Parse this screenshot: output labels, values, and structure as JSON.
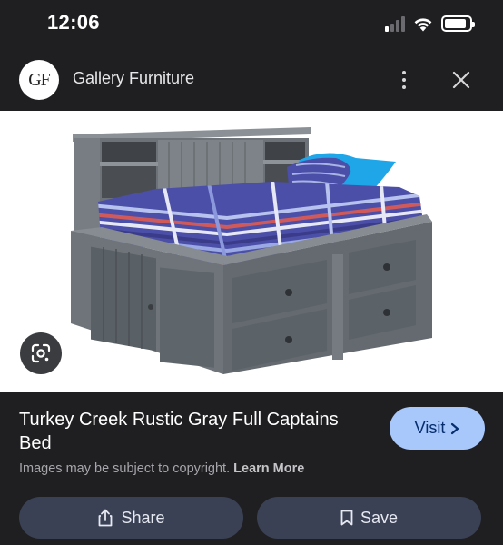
{
  "status_bar": {
    "time": "12:06",
    "signal_bars_active": 1,
    "battery_level": 0.9
  },
  "header": {
    "logo_text": "GF",
    "site_name": "Gallery Furniture"
  },
  "image": {
    "icons": [
      "google-lens-icon"
    ]
  },
  "product": {
    "title": "Turkey Creek Rustic Gray Full Captains Bed",
    "visit_label": "Visit",
    "copyright_text": "Images may be subject to copyright.",
    "learn_more_label": "Learn More"
  },
  "actions": {
    "share_label": "Share",
    "save_label": "Save"
  },
  "colors": {
    "background": "#1f1f22",
    "visit_button": "#a8c7fa",
    "action_button": "#3a4154",
    "comforter": "#4c4fa8",
    "pillow": "#1fa6e8",
    "wood": "#6f757a"
  }
}
